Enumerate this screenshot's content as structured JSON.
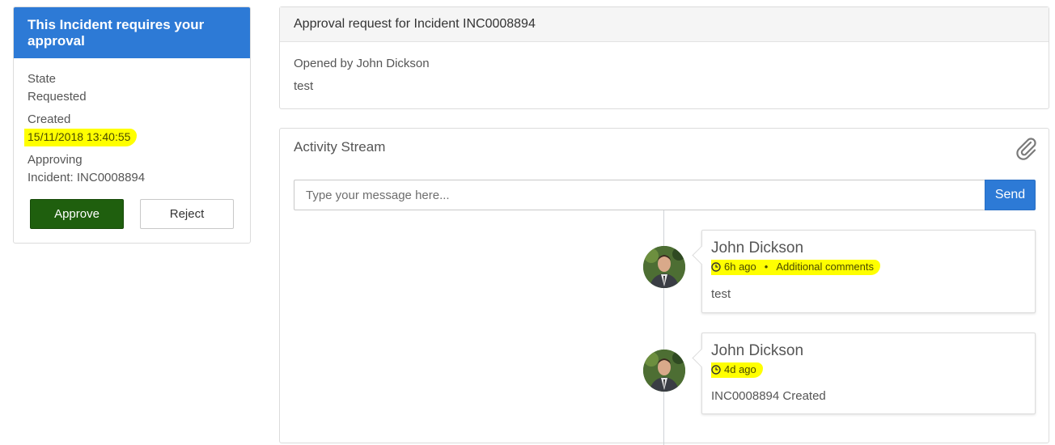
{
  "approval": {
    "header": "This Incident requires your approval",
    "state_label": "State",
    "state_value": "Requested",
    "created_label": "Created",
    "created_value": "15/11/2018 13:40:55",
    "approving_label": "Approving",
    "approving_value": "Incident: INC0008894",
    "approve_label": "Approve",
    "reject_label": "Reject"
  },
  "request": {
    "title": "Approval request for Incident INC0008894",
    "opened_by": "Opened by John Dickson",
    "description": "test"
  },
  "activity": {
    "title": "Activity Stream",
    "input_placeholder": "Type your message here...",
    "send_label": "Send",
    "entries": [
      {
        "author": "John Dickson",
        "time": "6h ago",
        "type": "Additional comments",
        "text": "test"
      },
      {
        "author": "John Dickson",
        "time": "4d ago",
        "type": "",
        "text": "INC0008894 Created"
      }
    ]
  },
  "colors": {
    "primary": "#2d7ad6",
    "approve": "#1f5f0e",
    "highlight": "#ffff00"
  },
  "icons": [
    "paperclip-icon",
    "clock-icon",
    "avatar"
  ]
}
